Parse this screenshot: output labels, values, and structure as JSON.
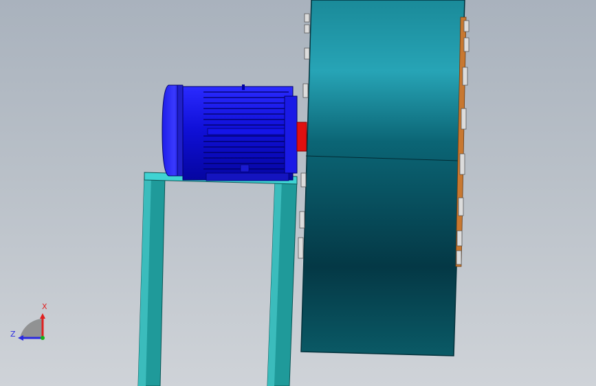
{
  "viewport": {
    "background_top": "#a9b2bd",
    "background_bottom": "#cfd3d8"
  },
  "model": {
    "motor_color": "#1a1ae0",
    "coupling_color": "#e01010",
    "housing_color": "#0e6f7e",
    "frame_color": "#2aa9a9",
    "flange_color": "#c87830"
  },
  "triad": {
    "x_label": "X",
    "z_label": "Z",
    "x_color": "#e02020",
    "z_color": "#2a2ae0"
  }
}
